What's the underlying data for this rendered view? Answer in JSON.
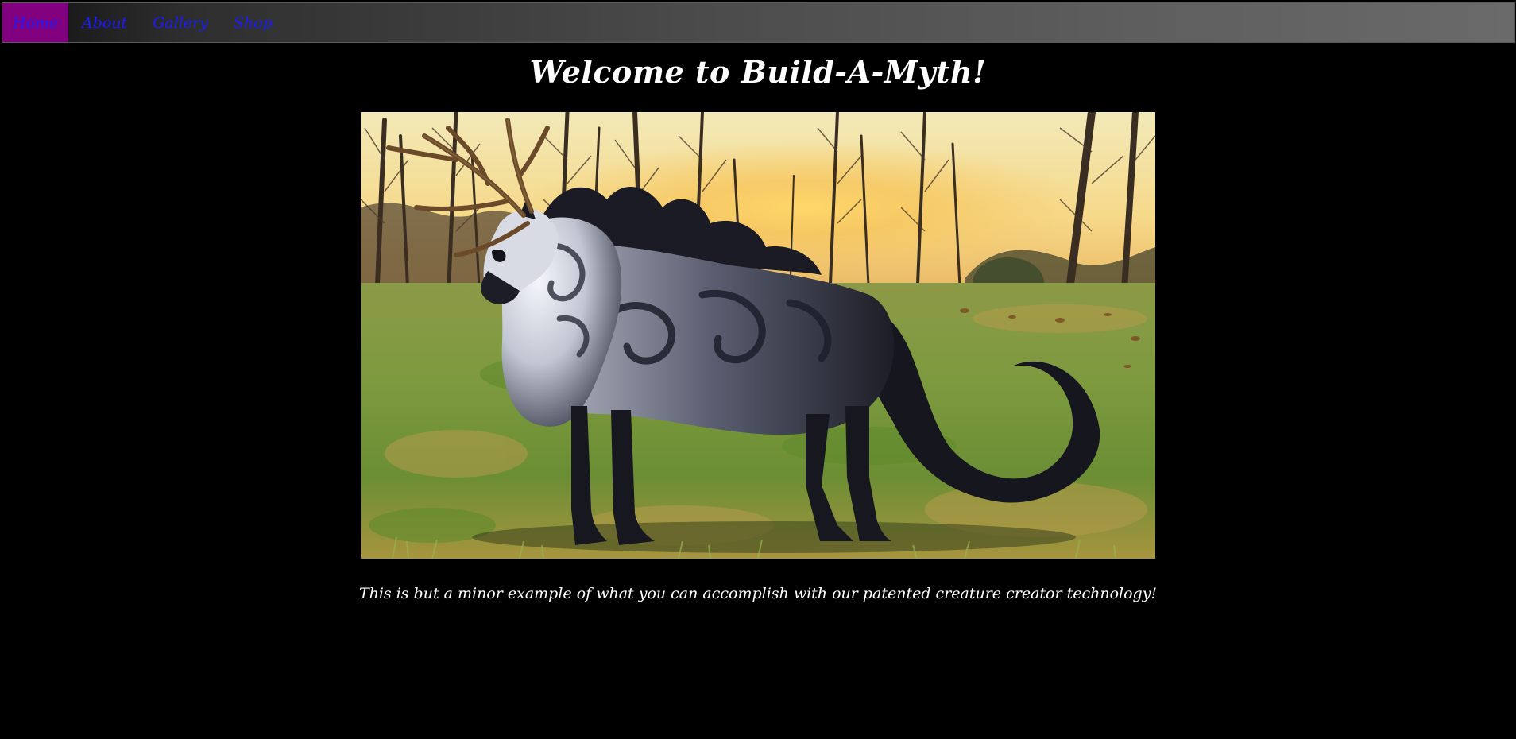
{
  "nav": {
    "items": [
      {
        "label": "Home",
        "active": true
      },
      {
        "label": "About",
        "active": false
      },
      {
        "label": "Gallery",
        "active": false
      },
      {
        "label": "Shop",
        "active": false
      }
    ],
    "active_bg_color": "#800080",
    "link_color": "#1a1aff"
  },
  "page": {
    "title": "Welcome to Build-A-Myth!",
    "caption": "This is but a minor example of what you can accomplish with our patented creature creator technology!"
  },
  "hero_image": {
    "subject": "antlered-wolf-creature-in-meadow"
  }
}
